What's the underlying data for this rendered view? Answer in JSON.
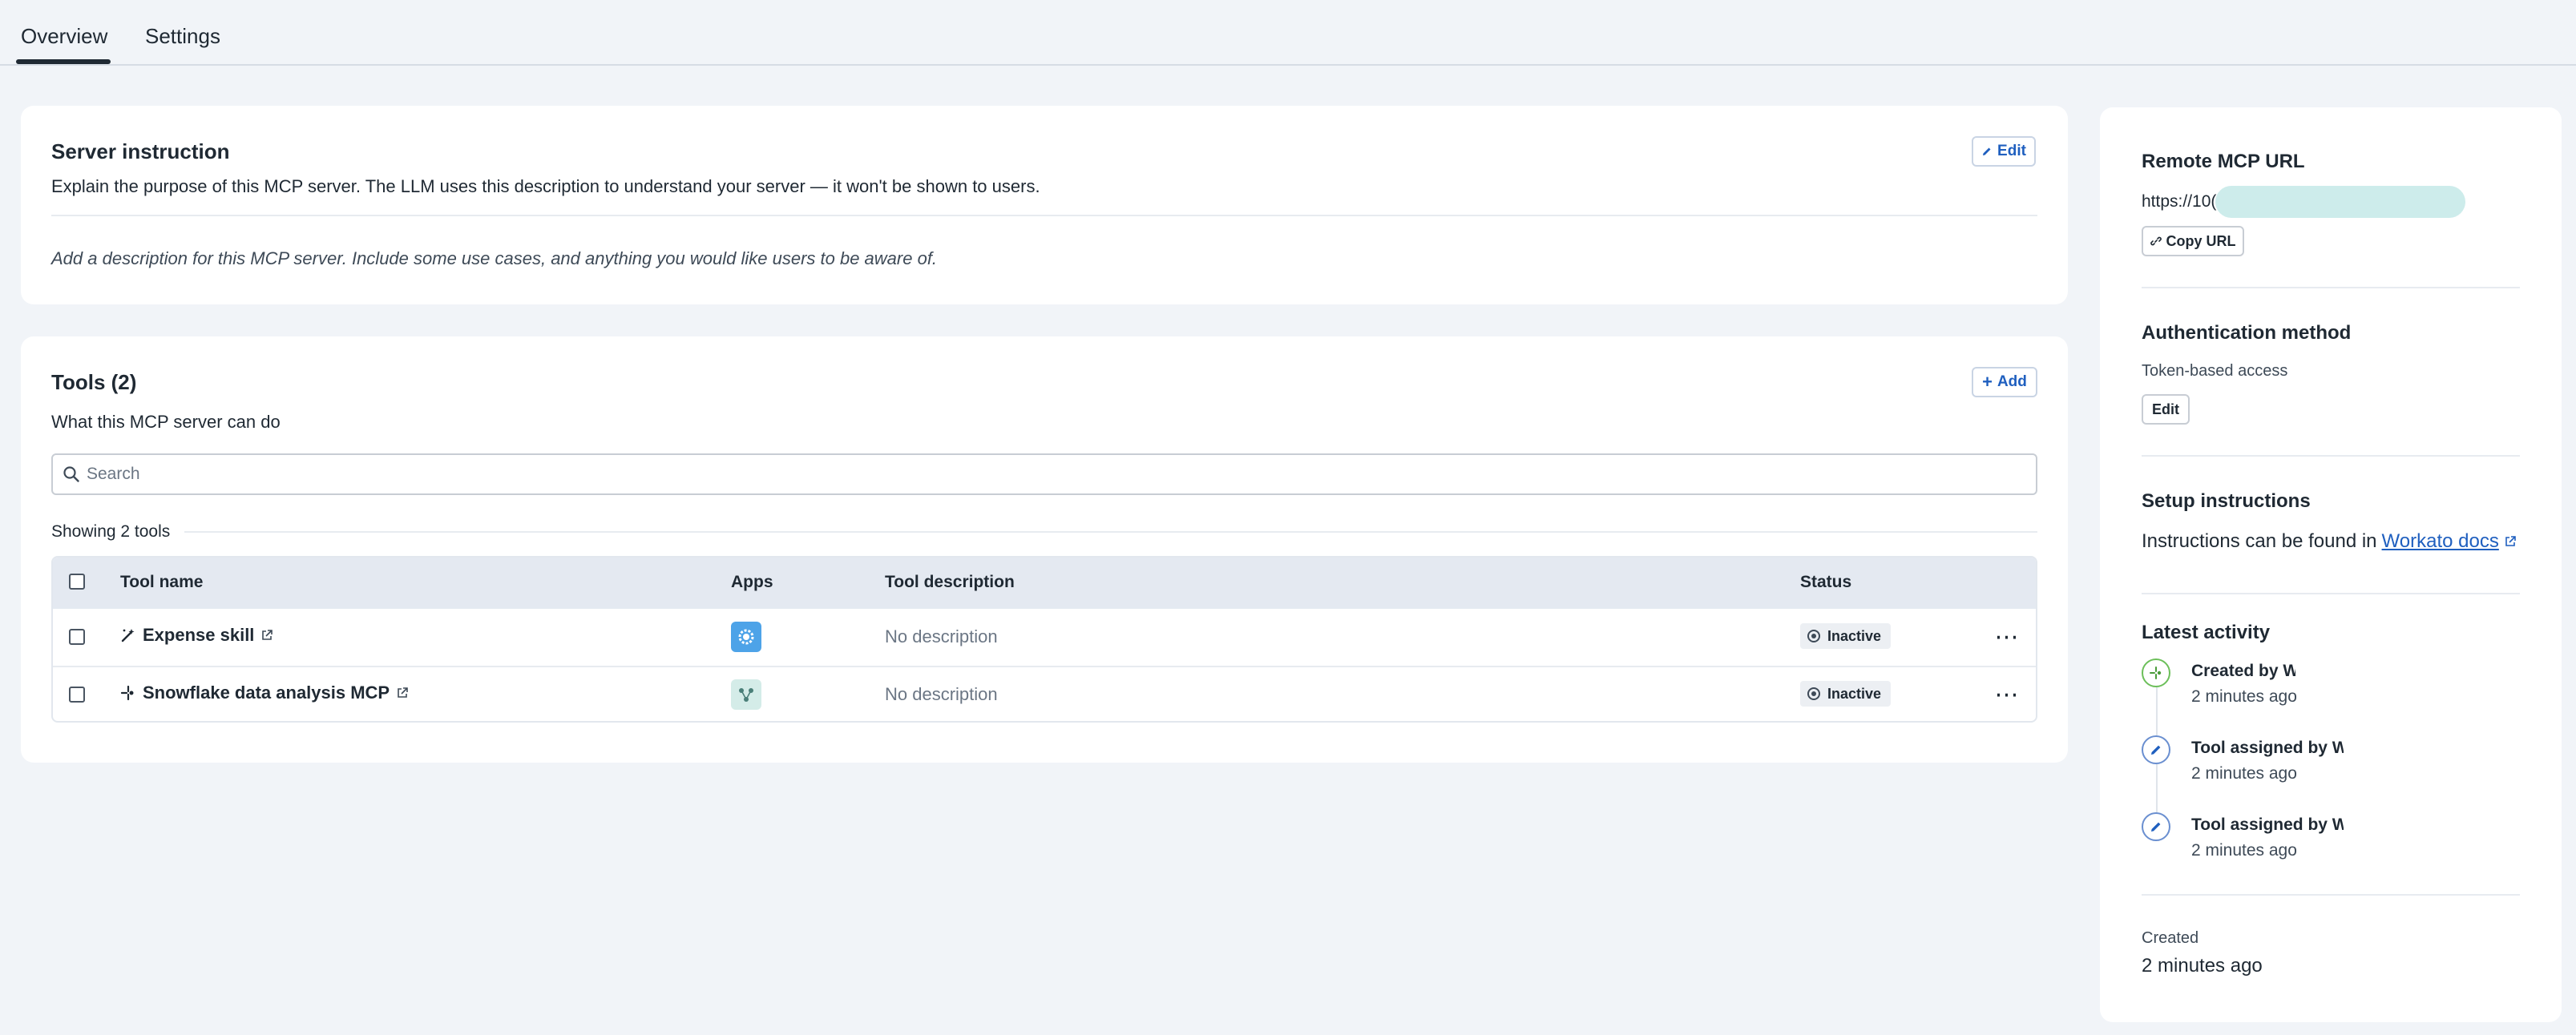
{
  "tabs": [
    {
      "label": "Overview",
      "active": true
    },
    {
      "label": "Settings",
      "active": false
    }
  ],
  "server_instruction": {
    "title": "Server instruction",
    "edit_label": "Edit",
    "subtitle": "Explain the purpose of this MCP server. The LLM uses this description to understand your server — it won't be shown to users.",
    "placeholder_text": "Add a description for this MCP server. Include some use cases, and anything you would like users to be aware of."
  },
  "tools": {
    "title": "Tools (2)",
    "add_label": "Add",
    "subtitle": "What this MCP server can do",
    "search_placeholder": "Search",
    "showing_text": "Showing 2 tools",
    "columns": {
      "name": "Tool name",
      "apps": "Apps",
      "description": "Tool description",
      "status": "Status"
    },
    "rows": [
      {
        "name": "Expense skill",
        "description": "No description",
        "status": "Inactive",
        "icon": "magic-wand-icon",
        "app_icon": "gear-app-icon",
        "app_color": "#4da3e8"
      },
      {
        "name": "Snowflake data analysis MCP",
        "description": "No description",
        "status": "Inactive",
        "icon": "mcp-nodes-icon",
        "app_icon": "nodes-app-icon",
        "app_color": "#d4ece8"
      }
    ]
  },
  "sidebar": {
    "remote_url": {
      "title": "Remote MCP URL",
      "url_prefix": "https://10(",
      "copy_label": "Copy URL"
    },
    "auth": {
      "title": "Authentication method",
      "value": "Token-based access",
      "edit_label": "Edit"
    },
    "setup": {
      "title": "Setup instructions",
      "text": "Instructions can be found in",
      "link": "Workato docs"
    },
    "activity": {
      "title": "Latest activity",
      "items": [
        {
          "title": "Created by W",
          "time": "2 minutes ago",
          "icon": "created-icon"
        },
        {
          "title": "Tool assigned by W",
          "time": "2 minutes ago",
          "icon": "pencil-icon"
        },
        {
          "title": "Tool assigned by W",
          "time": "2 minutes ago",
          "icon": "pencil-icon"
        }
      ]
    },
    "created": {
      "label": "Created",
      "value": "2 minutes ago"
    }
  },
  "colors": {
    "accent": "#1f5fbf",
    "background": "#f1f4f8",
    "url_mask": "#cdeceb"
  }
}
